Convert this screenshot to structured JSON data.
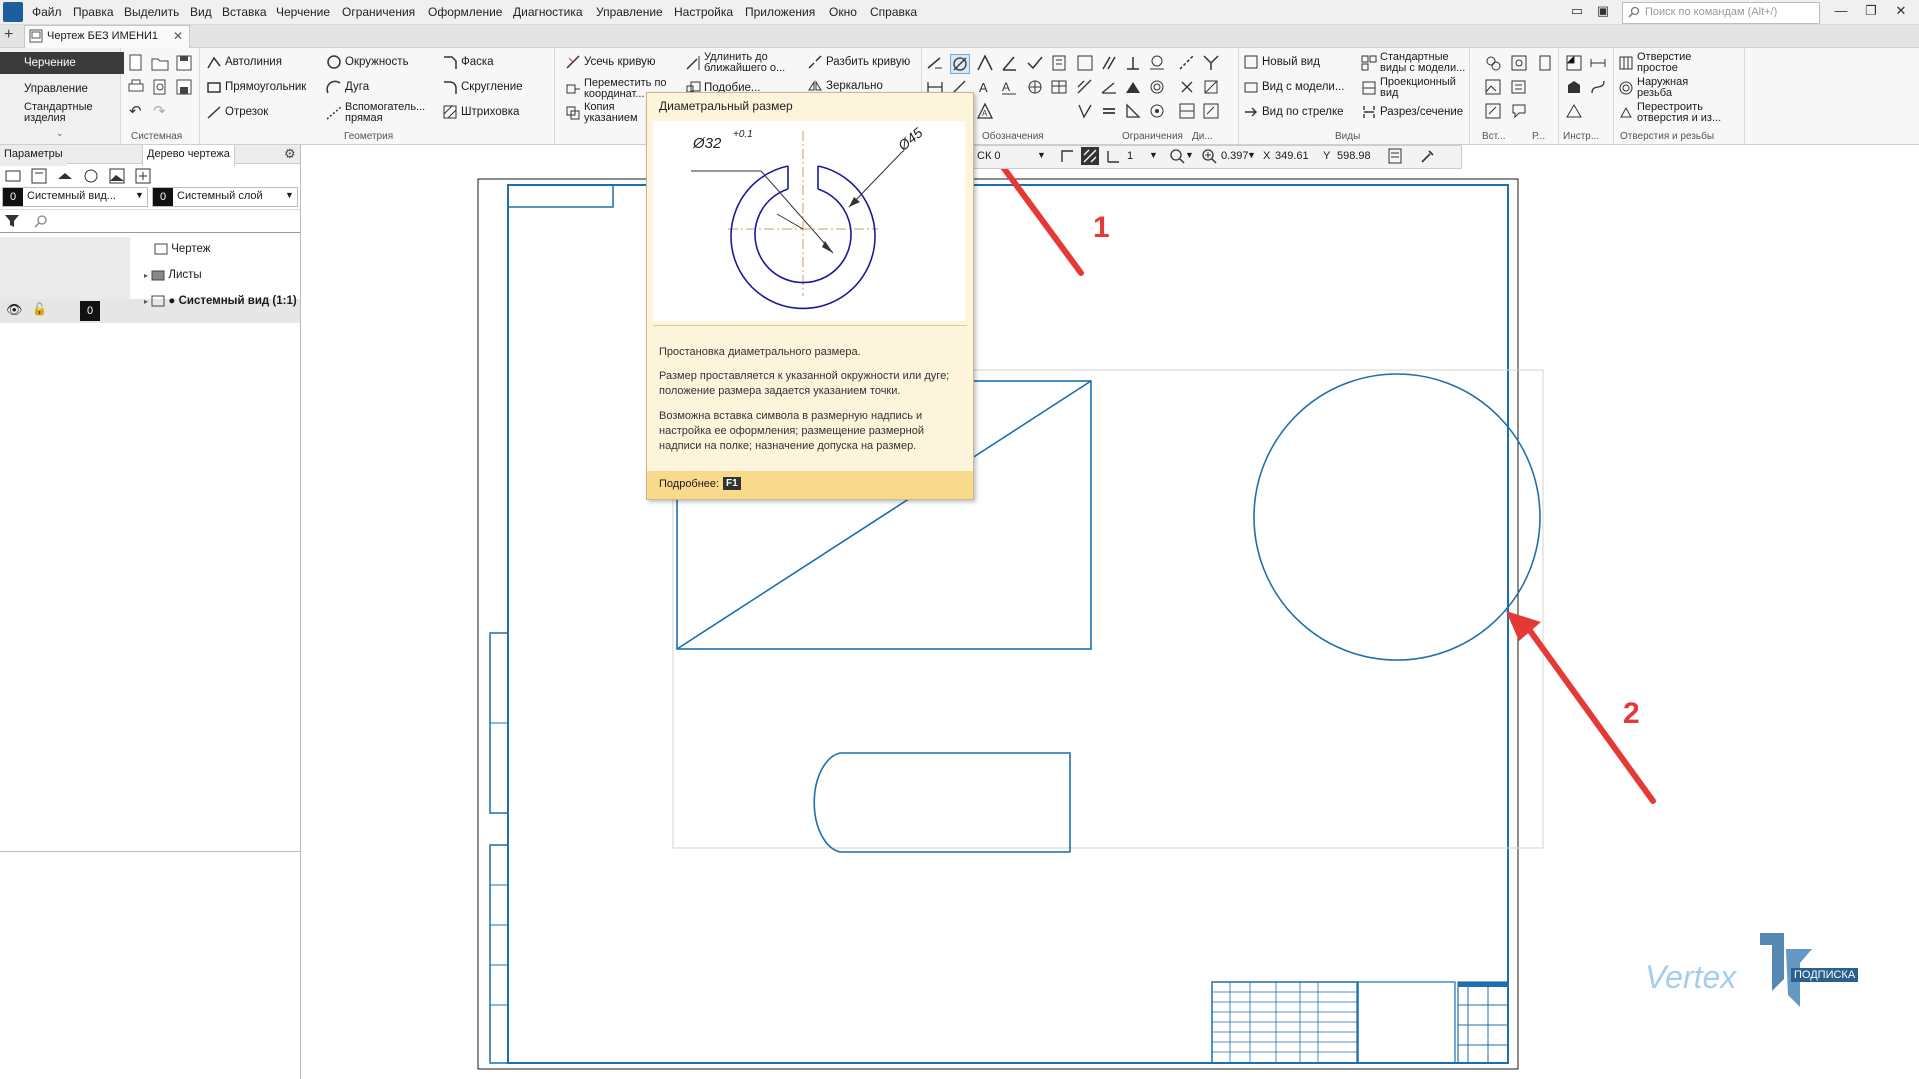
{
  "menu": [
    "Файл",
    "Правка",
    "Выделить",
    "Вид",
    "Вставка",
    "Черчение",
    "Ограничения",
    "Оформление",
    "Диагностика",
    "Управление",
    "Настройка",
    "Приложения",
    "Окно",
    "Справка"
  ],
  "search_placeholder": "Поиск по командам (Alt+/)",
  "document_tab": "Чертеж БЕЗ ИМЕНИ1",
  "ribbon": {
    "left_nav": [
      "Черчение",
      "Управление",
      "Стандартные изделия"
    ],
    "system_label": "Системная",
    "geometry_label": "Геометрия",
    "geometry": [
      "Автолиния",
      "Окружность",
      "Фаска",
      "Прямоугольник",
      "Дуга",
      "Скругление",
      "Отрезок",
      "Вспомогатель... прямая",
      "Штриховка"
    ],
    "edit": [
      "Усечь кривую",
      "Удлинить до ближайшего о...",
      "Разбить кривую",
      "Переместить по координат...",
      "Подобие...",
      "Зеркально",
      "Копия указанием"
    ],
    "constraints_label": "Ограничения",
    "views_label": "Виды",
    "views": [
      "Новый вид",
      "Стандартные виды с модели...",
      "Вид с модели...",
      "Проекционный вид",
      "Вид по стрелке",
      "Разрез/сечение"
    ],
    "insert_label": "Вст...",
    "instr_label": "Инстр...",
    "p_label": "Р...",
    "oboz_label": "Обозначения",
    "di_label": "Ди...",
    "holes_label": "Отверстия и резьбы",
    "holes": [
      "Отверстие простое",
      "Наружная резьба",
      "Перестроить отверстия и из..."
    ]
  },
  "left_panel": {
    "tabs": [
      "Параметры",
      "Дерево чертежа"
    ],
    "view_select": "Системный вид...",
    "view_num": "0",
    "layer_select": "Системный слой",
    "layer_num": "0",
    "tree": [
      "Чертеж",
      "Листы",
      "Системный вид (1:1)"
    ],
    "tree_badge": "0"
  },
  "coords": {
    "cs": "СК 0",
    "scale": "1",
    "zoom": "0.397",
    "x_label": "X",
    "x": "349.61",
    "y_label": "Y",
    "y": "598.98"
  },
  "tooltip": {
    "title": "Диаметральный размер",
    "dim1": "Ø32",
    "dim1_tol": "+0.1",
    "dim2": "Ø45",
    "p1": "Простановка диаметрального размера.",
    "p2": "Размер проставляется к указанной окружности или дуге; положение размера задается указанием точки.",
    "p3": "Возможна вставка символа в размерную надпись и настройка ее оформления; размещение размерной надписи на полке; назначение допуска на размер.",
    "more": "Подробнее:",
    "key": "F1"
  },
  "annotations": {
    "a1": "1",
    "a2": "2"
  },
  "watermark": {
    "brand": "Vertex",
    "sub": "ПОДПИСКА"
  },
  "colors": {
    "drawing": "#1c6fb0",
    "arrow": "#e53935",
    "accent": "#1d5f9c"
  }
}
